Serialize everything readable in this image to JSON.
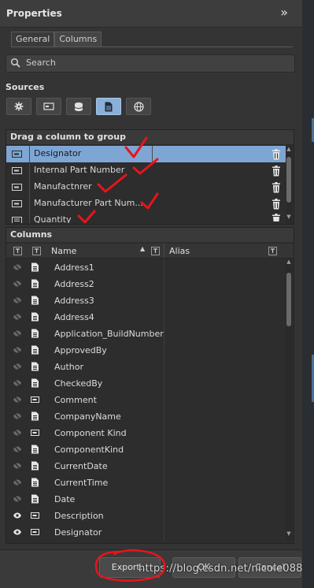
{
  "panel": {
    "title": "Properties",
    "expand_glyph": "»"
  },
  "tabs": [
    {
      "label": "General",
      "active": false
    },
    {
      "label": "Columns",
      "active": true
    }
  ],
  "search": {
    "placeholder": "Search"
  },
  "sources": {
    "label": "Sources",
    "buttons": [
      {
        "icon": "gear-icon",
        "active": false
      },
      {
        "icon": "component-icon",
        "active": false
      },
      {
        "icon": "database-icon",
        "active": false
      },
      {
        "icon": "document-icon",
        "active": true
      },
      {
        "icon": "globe-icon",
        "active": false
      }
    ]
  },
  "group": {
    "header": "Drag a column to group",
    "rows": [
      {
        "name": "Designator",
        "icon": "parameter-icon",
        "selected": true
      },
      {
        "name": "Internal Part Number",
        "icon": "parameter-icon",
        "selected": false
      },
      {
        "name": "Manufactnrer",
        "icon": "parameter-icon",
        "selected": false
      },
      {
        "name": "Manufacturer Part Num...",
        "icon": "parameter-icon",
        "selected": false
      },
      {
        "name": "Quantity",
        "icon": "list-icon",
        "selected": false
      }
    ]
  },
  "columns": {
    "header": "Columns",
    "col_name": "Name",
    "col_alias": "Alias",
    "rows": [
      {
        "name": "Address1",
        "visible": false,
        "type": "document"
      },
      {
        "name": "Address2",
        "visible": false,
        "type": "document"
      },
      {
        "name": "Address3",
        "visible": false,
        "type": "document"
      },
      {
        "name": "Address4",
        "visible": false,
        "type": "document"
      },
      {
        "name": "Application_BuildNumber",
        "visible": false,
        "type": "document"
      },
      {
        "name": "ApprovedBy",
        "visible": false,
        "type": "document"
      },
      {
        "name": "Author",
        "visible": false,
        "type": "document"
      },
      {
        "name": "CheckedBy",
        "visible": false,
        "type": "document"
      },
      {
        "name": "Comment",
        "visible": false,
        "type": "parameter"
      },
      {
        "name": "CompanyName",
        "visible": false,
        "type": "document"
      },
      {
        "name": "Component Kind",
        "visible": false,
        "type": "parameter"
      },
      {
        "name": "ComponentKind",
        "visible": false,
        "type": "document"
      },
      {
        "name": "CurrentDate",
        "visible": false,
        "type": "document"
      },
      {
        "name": "CurrentTime",
        "visible": false,
        "type": "document"
      },
      {
        "name": "Date",
        "visible": false,
        "type": "document"
      },
      {
        "name": "Description",
        "visible": true,
        "type": "parameter"
      },
      {
        "name": "Designator",
        "visible": true,
        "type": "parameter"
      }
    ]
  },
  "footer": {
    "export_label": "Export...",
    "ok_label": "OK",
    "cancel_label": "Cancel",
    "watermark": "https://blog.csdn.net/nicole088"
  },
  "colors": {
    "selected_row": "#7ea6d4",
    "annotation": "#e8141c",
    "active_source": "#8ab0da"
  }
}
